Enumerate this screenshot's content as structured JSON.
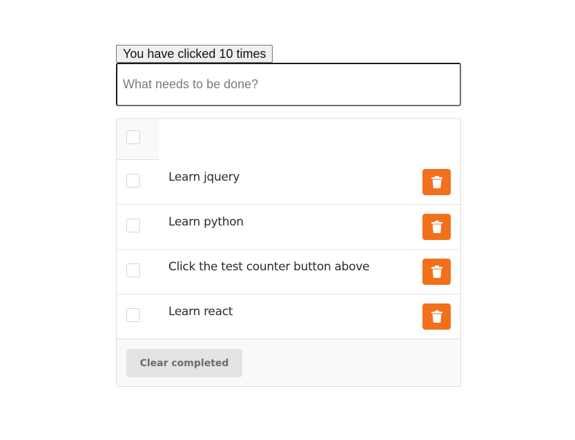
{
  "counter": {
    "label": "You have clicked 10 times"
  },
  "new_todo": {
    "placeholder": "What needs to be done?",
    "value": ""
  },
  "todos": [
    {
      "label": "Learn jquery",
      "completed": false
    },
    {
      "label": "Learn python",
      "completed": false
    },
    {
      "label": "Click the test counter button above",
      "completed": false
    },
    {
      "label": "Learn react",
      "completed": false
    }
  ],
  "footer": {
    "clear_label": "Clear completed"
  },
  "icons": {
    "delete": "trash-icon",
    "toggle_all": "checkbox"
  },
  "colors": {
    "delete_button": "#f26f1b",
    "clear_button": "#e2e3e5",
    "panel_background": "#f8f9fa"
  }
}
